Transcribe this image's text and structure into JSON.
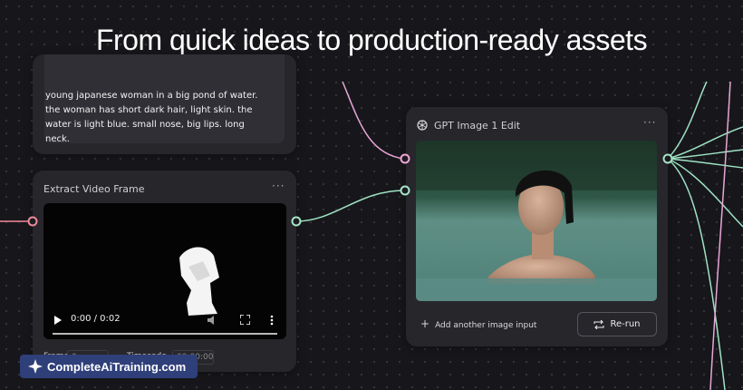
{
  "headline": "From quick ideas to production-ready assets",
  "prompt_node": {
    "text": "young japanese woman in a big pond of water. the woman has short dark hair, light skin. the water is light blue. small nose, big lips. long neck."
  },
  "extract_node": {
    "title": "Extract Video Frame",
    "menu_icon": "more-horizontal-icon",
    "video_time": "0:00 / 0:02",
    "frame_label": "Frame",
    "frame_value": "0",
    "timecode_label": "Timecode",
    "timecode_value": "00:00:00"
  },
  "gpt_node": {
    "title": "GPT Image 1 Edit",
    "menu_icon": "more-horizontal-icon",
    "add_input_label": "Add another image input",
    "rerun_label": "Re-run"
  },
  "watermark": {
    "text": "CompleteAiTraining.com"
  },
  "colors": {
    "background": "#17171b",
    "node": "#26262b",
    "wire_pink": "#e8a6d8",
    "wire_green": "#9fe3c4",
    "port_pink": "#f2a7d6",
    "port_green": "#a6e6c8",
    "port_red": "#f08a9a",
    "watermark": "#2f3f7a"
  }
}
